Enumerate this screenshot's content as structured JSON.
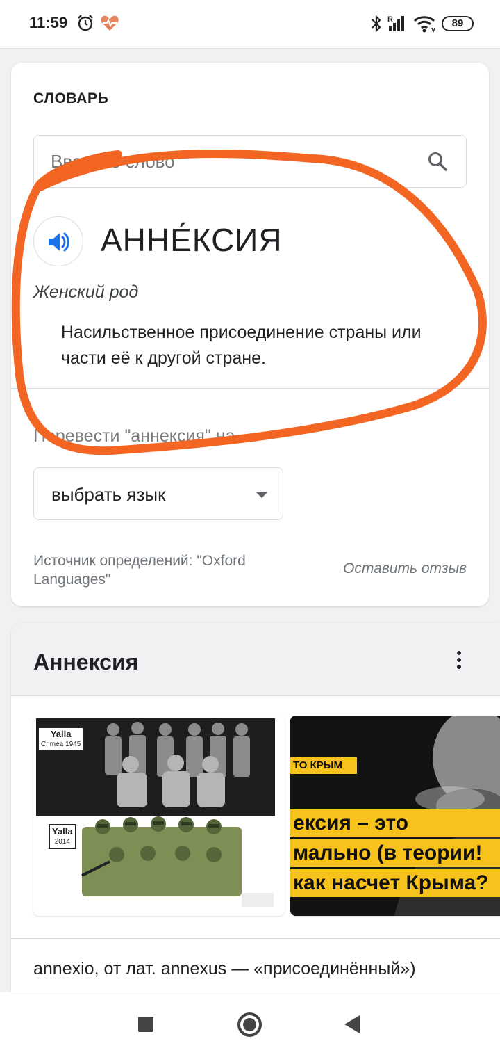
{
  "status_bar": {
    "time": "11:59",
    "battery": "89",
    "icons": [
      "alarm-icon",
      "health-heart-icon",
      "bluetooth-icon",
      "signal-icon",
      "wifi-icon",
      "battery-icon"
    ]
  },
  "dictionary": {
    "label": "СЛОВАРЬ",
    "search_placeholder": "Введите слово",
    "headword": "АННЕ́КСИЯ",
    "gender": "Женский род",
    "definition": "Насильственное присоединение страны или части её к другой стране.",
    "translate_label": "Перевести \"аннексия\" на",
    "language_select": "выбрать язык",
    "source": "Источник определений: \"Oxford Languages\"",
    "feedback": "Оставить отзыв"
  },
  "annotation": {
    "color": "#f26522"
  },
  "knowledge_card": {
    "title": "Аннексия",
    "images": [
      {
        "name": "yalla-cartoon",
        "tags": [
          {
            "line1": "Yalla",
            "line2": "Crimea 1945"
          },
          {
            "line1": "Yalla",
            "line2": "2014"
          }
        ]
      },
      {
        "name": "crimea-video-thumb",
        "top_label": "ТО КРЫМ",
        "caption_lines": [
          "ексия – это",
          "мально (в теории!",
          "как насчет Крыма?"
        ]
      }
    ],
    "etymology": "annexio, от лат. annexus — «присоединённый»)"
  },
  "colors": {
    "accent_blue": "#1a73e8",
    "yellow_caption": "#f8c21c"
  }
}
